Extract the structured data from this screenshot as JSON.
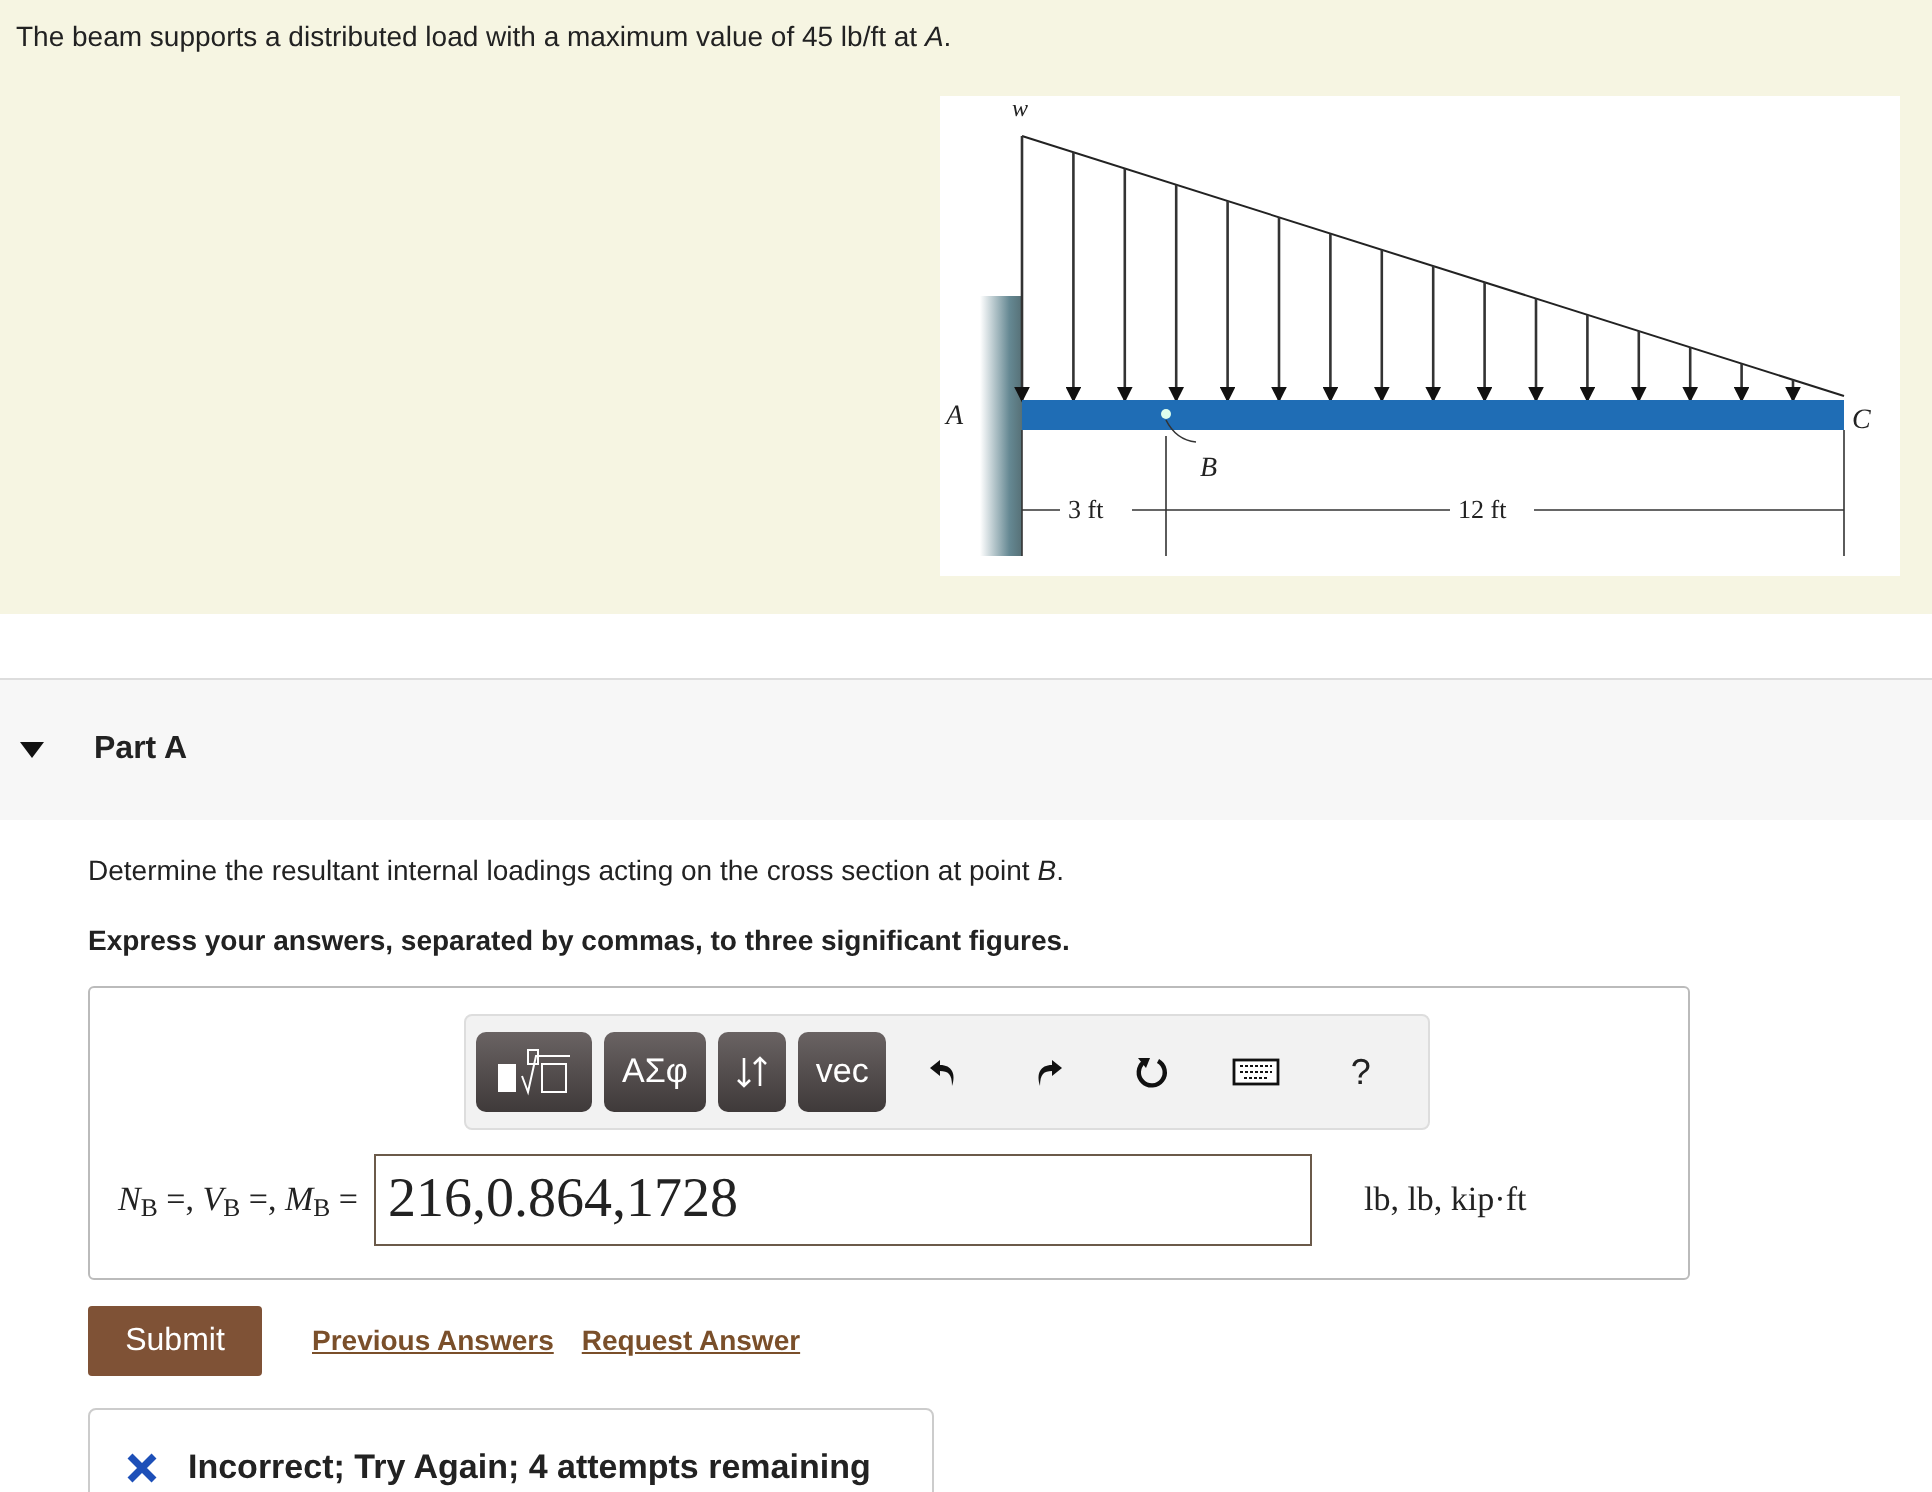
{
  "problem": {
    "statement": "The beam supports a distributed load with a maximum value of 45 lb/ft at *A*.",
    "figure": {
      "load_label": "w",
      "end_label_left": "A",
      "point_label": "B",
      "end_label_right": "C",
      "dim_left": "3 ft",
      "dim_right": "12 ft"
    }
  },
  "part": {
    "title": "Part A",
    "expanded": true,
    "question": "Determine the resultant internal loadings acting on the cross section at point *B*.",
    "instruction": "Express your answers, separated by commas, to three significant figures.",
    "toolbar": [
      {
        "kind": "templates"
      },
      {
        "kind": "text",
        "label": "ΑΣφ"
      },
      {
        "kind": "arrows"
      },
      {
        "kind": "text",
        "label": "vec"
      },
      {
        "kind": "undo"
      },
      {
        "kind": "redo"
      },
      {
        "kind": "reset"
      },
      {
        "kind": "keyboard"
      },
      {
        "kind": "help",
        "label": "?"
      }
    ],
    "answer_label": "*N*$_{B}$ =, *V*$_{B}$ =, *M*$_{B}$ =",
    "answer_value": "216,0.864,1728",
    "units": "lb, lb, kip·ft",
    "submit": "Submit",
    "links": [
      "Previous Answers",
      "Request Answer"
    ],
    "feedback": {
      "correct": false,
      "text": "Incorrect; Try Again; 4 attempts remaining"
    }
  }
}
